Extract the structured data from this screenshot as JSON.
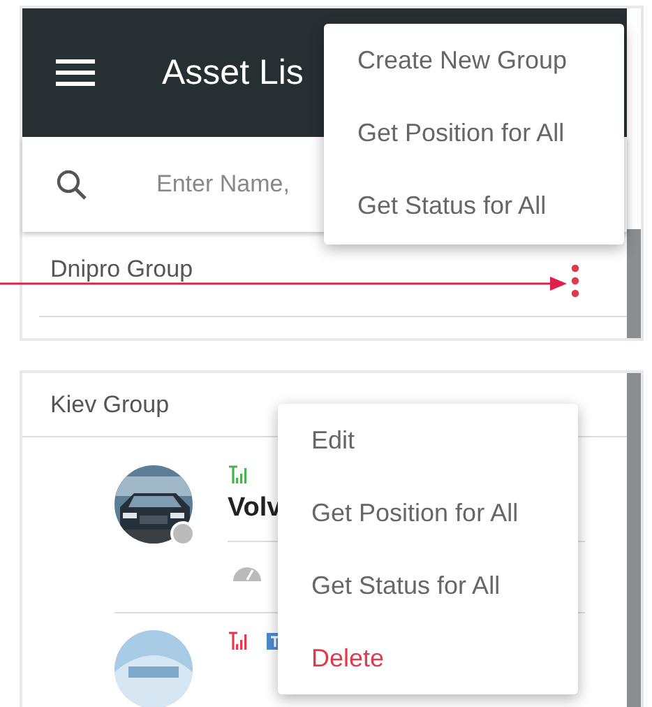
{
  "header": {
    "title": "Asset Lis"
  },
  "search": {
    "placeholder": "Enter Name,"
  },
  "top_group": {
    "name": "Dnipro Group"
  },
  "top_menu": {
    "items": [
      {
        "label": "Create New Group",
        "kind": "normal"
      },
      {
        "label": "Get Position for All",
        "kind": "normal"
      },
      {
        "label": "Get Status for All",
        "kind": "normal"
      }
    ]
  },
  "kiev_group": {
    "name": "Kiev Group",
    "assets": [
      {
        "name": "Volv",
        "color": "#4caf50"
      },
      {
        "color": "#e53950"
      }
    ]
  },
  "group_menu": {
    "items": [
      {
        "label": "Edit",
        "kind": "normal"
      },
      {
        "label": "Get Position for All",
        "kind": "normal"
      },
      {
        "label": "Get Status for All",
        "kind": "normal"
      },
      {
        "label": "Delete",
        "kind": "danger"
      }
    ]
  }
}
